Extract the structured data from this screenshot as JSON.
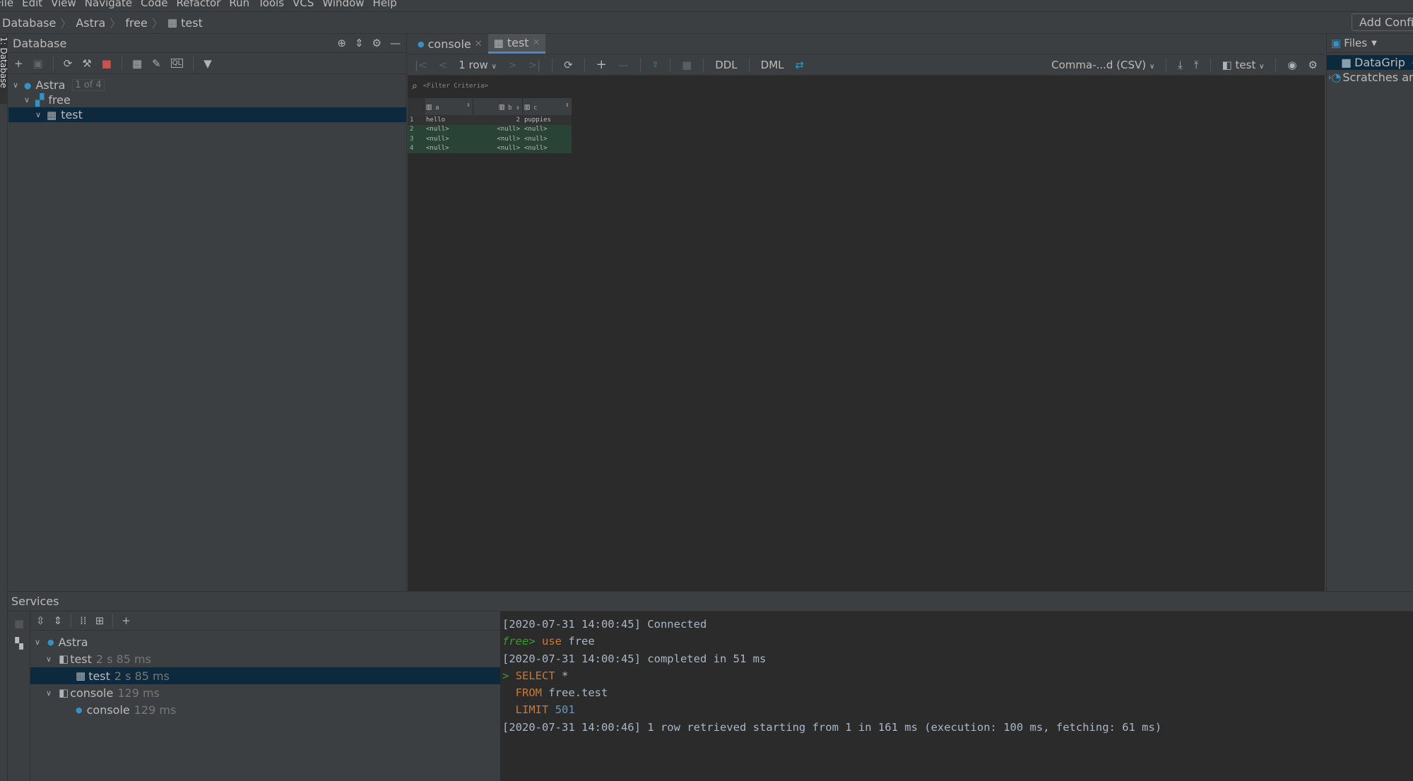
{
  "menu": [
    "File",
    "Edit",
    "View",
    "Navigate",
    "Code",
    "Refactor",
    "Run",
    "Tools",
    "VCS",
    "Window",
    "Help"
  ],
  "breadcrumb": [
    "Database",
    "Astra",
    "free",
    "test"
  ],
  "add_config": "Add Configuration...",
  "left_tool_tab": "1: Database",
  "db_panel": {
    "title": "Database",
    "tree": [
      {
        "label": "Astra",
        "badge": "1 of 4",
        "icon": "datasource-icon"
      },
      {
        "label": "free",
        "icon": "schema-icon"
      },
      {
        "label": "test",
        "icon": "table-icon",
        "selected": true
      }
    ]
  },
  "editor": {
    "tabs": [
      {
        "label": "console",
        "icon": "console-icon"
      },
      {
        "label": "test",
        "icon": "table-icon",
        "active": true
      }
    ],
    "toolbar": {
      "rows": "1 row",
      "ddl": "DDL",
      "dml": "DML",
      "export_format": "Comma-...d (CSV)",
      "session": "test"
    },
    "filter_placeholder": "<Filter Criteria>",
    "grid": {
      "columns": [
        "a",
        "b",
        "c"
      ],
      "rows": [
        [
          "1",
          "hello",
          "2",
          "puppies"
        ],
        [
          "2",
          "<null>",
          "<null>",
          "<null>"
        ],
        [
          "3",
          "<null>",
          "<null>",
          "<null>"
        ],
        [
          "4",
          "<null>",
          "<null>",
          "<null>"
        ]
      ]
    }
  },
  "files_panel": {
    "title": "Files",
    "items": [
      {
        "label": "DataGrip",
        "suffix": "~",
        "selected": true
      },
      {
        "label": "Scratches and Consoles"
      }
    ]
  },
  "services": {
    "title": "Services",
    "tree": [
      {
        "label": "Astra",
        "time": ""
      },
      {
        "label": "test",
        "time": "2 s 85 ms"
      },
      {
        "label": "test",
        "time": "2 s 85 ms",
        "selected": true
      },
      {
        "label": "console",
        "time": "129 ms"
      },
      {
        "label": "console",
        "time": "129 ms"
      }
    ]
  },
  "console": {
    "l1": "[2020-07-31 14:00:45] Connected",
    "prompt": "free>",
    "use_kw": "use",
    "use_arg": "free",
    "l3": "[2020-07-31 14:00:45] completed in 51 ms",
    "select": "SELECT",
    "star": "*",
    "from": "FROM",
    "from_arg": "free.test",
    "limit": "LIMIT",
    "limit_n": "501",
    "l7": "[2020-07-31 14:00:46] 1 row retrieved starting from 1 in 161 ms (execution: 100 ms, fetching: 61 ms)"
  },
  "colors": {
    "selection": "#0d293e",
    "accent": "#4a88c7",
    "inserted_row": "#294436",
    "keyword": "#cc7832"
  }
}
